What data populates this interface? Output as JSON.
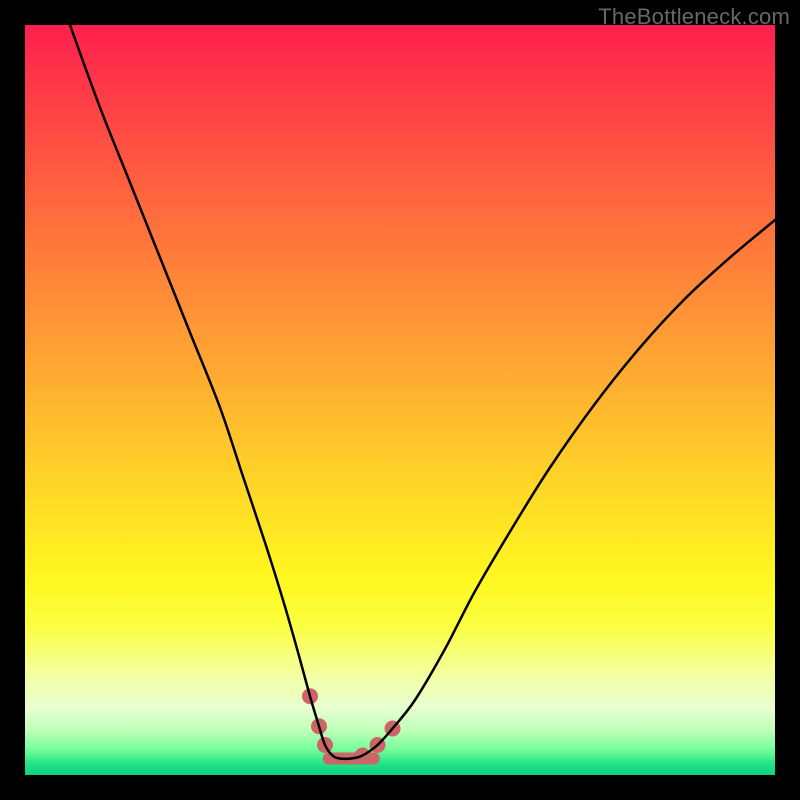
{
  "watermark": "TheBottleneck.com",
  "chart_data": {
    "type": "line",
    "title": "",
    "xlabel": "",
    "ylabel": "",
    "xlim": [
      0,
      100
    ],
    "ylim": [
      0,
      100
    ],
    "grid": false,
    "gradient_stops": [
      {
        "pct": 0,
        "hex": "#ff1f4e"
      },
      {
        "pct": 6,
        "hex": "#ff3249"
      },
      {
        "pct": 18,
        "hex": "#ff5641"
      },
      {
        "pct": 30,
        "hex": "#ff7a3b"
      },
      {
        "pct": 42,
        "hex": "#ff9d34"
      },
      {
        "pct": 54,
        "hex": "#ffc12c"
      },
      {
        "pct": 66,
        "hex": "#ffe324"
      },
      {
        "pct": 74,
        "hex": "#fff820"
      },
      {
        "pct": 80,
        "hex": "#fbff3f"
      },
      {
        "pct": 87,
        "hex": "#f3ffa6"
      },
      {
        "pct": 91,
        "hex": "#e8ffd0"
      },
      {
        "pct": 94,
        "hex": "#c0ffb8"
      },
      {
        "pct": 96.5,
        "hex": "#79ff9a"
      },
      {
        "pct": 98.5,
        "hex": "#22e487"
      },
      {
        "pct": 100,
        "hex": "#0fd07e"
      }
    ],
    "series": [
      {
        "name": "bottleneck-curve",
        "color": "#000000",
        "x": [
          6,
          10,
          14,
          18,
          22,
          26,
          29,
          32,
          34.5,
          36.5,
          38,
          39.2,
          40,
          41,
          42,
          43.5,
          45,
          47,
          49,
          52,
          56,
          60,
          65,
          70,
          76,
          82,
          88,
          94,
          100
        ],
        "y": [
          100,
          89,
          79,
          69,
          59,
          49,
          40,
          31,
          23,
          16,
          10.5,
          6.5,
          4.0,
          2.6,
          2.2,
          2.2,
          2.6,
          4.0,
          6.2,
          10.0,
          16.8,
          24.5,
          33.0,
          41.0,
          49.5,
          57.0,
          63.5,
          69.0,
          74.0
        ]
      }
    ],
    "markers": {
      "name": "highlight-dots",
      "color": "#cc6666",
      "radius_px": 8,
      "points": [
        {
          "x": 38.0,
          "y": 10.5
        },
        {
          "x": 39.2,
          "y": 6.5
        },
        {
          "x": 40.0,
          "y": 4.0
        },
        {
          "x": 45.0,
          "y": 2.6
        },
        {
          "x": 47.0,
          "y": 4.0
        },
        {
          "x": 49.0,
          "y": 6.2
        }
      ]
    },
    "bottom_band": {
      "name": "trough-band",
      "color": "#cc6666",
      "stroke_px": 12,
      "x_from": 40.5,
      "x_to": 46.5,
      "y": 2.2
    }
  }
}
